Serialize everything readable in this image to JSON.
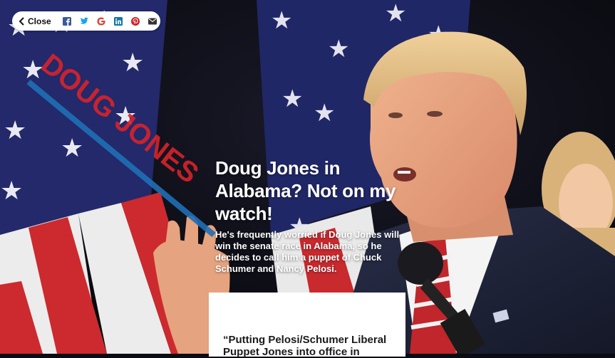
{
  "share_bar": {
    "close_label": "Close",
    "icons": [
      "facebook-icon",
      "twitter-icon",
      "google-icon",
      "linkedin-icon",
      "pinterest-icon",
      "email-icon"
    ]
  },
  "article": {
    "headline": "Doug Jones in Alabama? Not on my watch!",
    "dek": "He's frequently worried if Doug Jones will win the senate race in Alabama, so he decides to call him a puppet of Chuck Schumer and Nancy Pelosi.",
    "quote": "“Putting Pelosi/Schumer Liberal Puppet Jones into office in",
    "sign_text": "DOUG JONES"
  },
  "colors": {
    "facebook": "#3b5998",
    "twitter": "#1da1f2",
    "google": "#db4437",
    "linkedin": "#0e76a8",
    "pinterest": "#cb2027",
    "email": "#333333",
    "sign_red": "#d8232a",
    "sign_blue": "#1f6fb5"
  }
}
